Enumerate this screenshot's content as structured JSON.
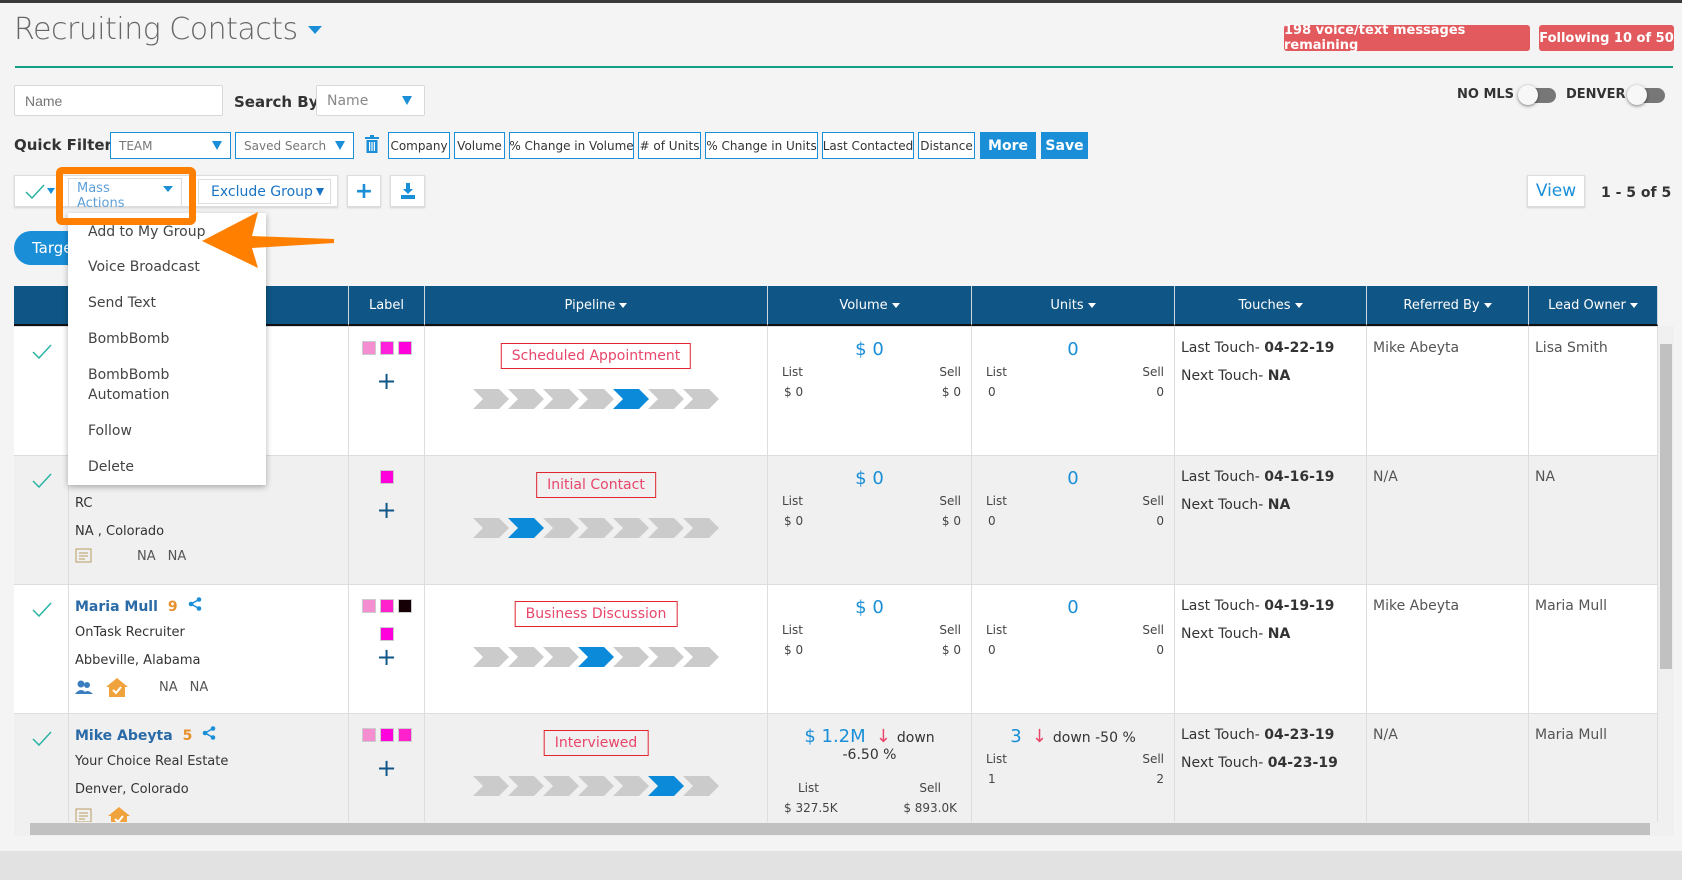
{
  "header": {
    "title": "Recruiting Contacts",
    "messages_badge": "198 voice/text messages remaining",
    "following_badge": "Following 10 of 50"
  },
  "search": {
    "name_placeholder": "Name",
    "search_by_label": "Search By:",
    "search_by_value": "Name"
  },
  "toggles": [
    {
      "label": "NO MLS",
      "on": false
    },
    {
      "label": "DENVER",
      "on": false
    }
  ],
  "quick_filter": {
    "label": "Quick Filter:",
    "team": "TEAM",
    "saved_search": "Saved Search",
    "buttons": [
      "Company",
      "Volume",
      "% Change in Volume",
      "# of Units",
      "% Change in Units",
      "Last Contacted",
      "Distance"
    ],
    "more": "More",
    "save": "Save"
  },
  "actions": {
    "mass_actions": "Mass Actions",
    "exclude_group": "Exclude Group",
    "view": "View",
    "pagination": "1 - 5 of 5",
    "target_pill": "Targe"
  },
  "mass_actions_menu": [
    "Add to My Group",
    "Voice Broadcast",
    "Send Text",
    "BombBomb",
    "BombBomb Automation",
    "Follow",
    "Delete"
  ],
  "colors": {
    "accent": "#1a8fd8",
    "header": "#0f5585",
    "badge": "#e35a5e",
    "highlight": "#ff8000",
    "rule": "#12a085"
  },
  "table": {
    "columns": [
      "",
      "",
      "Label",
      "Pipeline",
      "Volume",
      "Units",
      "Touches",
      "Referred By",
      "Lead Owner"
    ],
    "rows": [
      {
        "name": "",
        "score": "",
        "company": "",
        "location": "",
        "icons": [],
        "na": [],
        "labels": [
          [
            "#f58ed0",
            "#ff22dd",
            "#ff00dd"
          ]
        ],
        "stage": "Scheduled Appointment",
        "stage_index": 4,
        "volume": {
          "main": "$ 0",
          "trend": "",
          "list_label": "List",
          "sell_label": "Sell",
          "list": "$ 0",
          "sell": "$ 0"
        },
        "units": {
          "main": "0",
          "trend": "",
          "list_label": "List",
          "sell_label": "Sell",
          "list": "0",
          "sell": "0"
        },
        "last_touch_label": "Last Touch- ",
        "last_touch": "04-22-19",
        "next_touch_label": "Next Touch- ",
        "next_touch": "NA",
        "referred_by": "Mike Abeyta",
        "lead_owner": "Lisa Smith"
      },
      {
        "name": "",
        "score": "",
        "company": "RC",
        "location": "NA , Colorado",
        "icons": [
          "notes-icon"
        ],
        "na": [
          "NA",
          "NA"
        ],
        "labels": [
          [
            "#ff00dd"
          ]
        ],
        "stage": "Initial Contact",
        "stage_index": 1,
        "volume": {
          "main": "$ 0",
          "trend": "",
          "list_label": "List",
          "sell_label": "Sell",
          "list": "$ 0",
          "sell": "$ 0"
        },
        "units": {
          "main": "0",
          "trend": "",
          "list_label": "List",
          "sell_label": "Sell",
          "list": "0",
          "sell": "0"
        },
        "last_touch_label": "Last Touch- ",
        "last_touch": "04-16-19",
        "next_touch_label": "Next Touch- ",
        "next_touch": "NA",
        "referred_by": "N/A",
        "lead_owner": "NA"
      },
      {
        "name": "Maria Mull",
        "score": "9",
        "company": "OnTask Recruiter",
        "location": "Abbeville, Alabama",
        "icons": [
          "team-icon",
          "house-check-icon"
        ],
        "na": [
          "NA",
          "NA"
        ],
        "labels": [
          [
            "#f58ed0",
            "#ff22cc",
            "#150005"
          ],
          [
            "#ff00dd"
          ]
        ],
        "stage": "Business Discussion",
        "stage_index": 3,
        "volume": {
          "main": "$ 0",
          "trend": "",
          "list_label": "List",
          "sell_label": "Sell",
          "list": "$ 0",
          "sell": "$ 0"
        },
        "units": {
          "main": "0",
          "trend": "",
          "list_label": "List",
          "sell_label": "Sell",
          "list": "0",
          "sell": "0"
        },
        "last_touch_label": "Last Touch- ",
        "last_touch": "04-19-19",
        "next_touch_label": "Next Touch- ",
        "next_touch": "NA",
        "referred_by": "Mike Abeyta",
        "lead_owner": "Maria Mull"
      },
      {
        "name": "Mike Abeyta",
        "score": "5",
        "company": "Your Choice Real Estate",
        "location": "Denver, Colorado",
        "icons": [
          "notes-icon",
          "house-check-icon"
        ],
        "na": [],
        "labels": [
          [
            "#f58ed0",
            "#ff00dd",
            "#ff22cc"
          ]
        ],
        "stage": "Interviewed",
        "stage_index": 5,
        "volume": {
          "main": "$ 1.2M",
          "trend": "down -6.50 %",
          "list_label": "List",
          "sell_label": "Sell",
          "list": "$ 327.5K",
          "sell": "$ 893.0K"
        },
        "units": {
          "main": "3",
          "trend": "down -50 %",
          "list_label": "List",
          "sell_label": "Sell",
          "list": "1",
          "sell": "2"
        },
        "last_touch_label": "Last Touch- ",
        "last_touch": "04-23-19",
        "next_touch_label": "Next Touch- ",
        "next_touch": "04-23-19",
        "referred_by": "N/A",
        "lead_owner": "Maria Mull"
      }
    ]
  }
}
